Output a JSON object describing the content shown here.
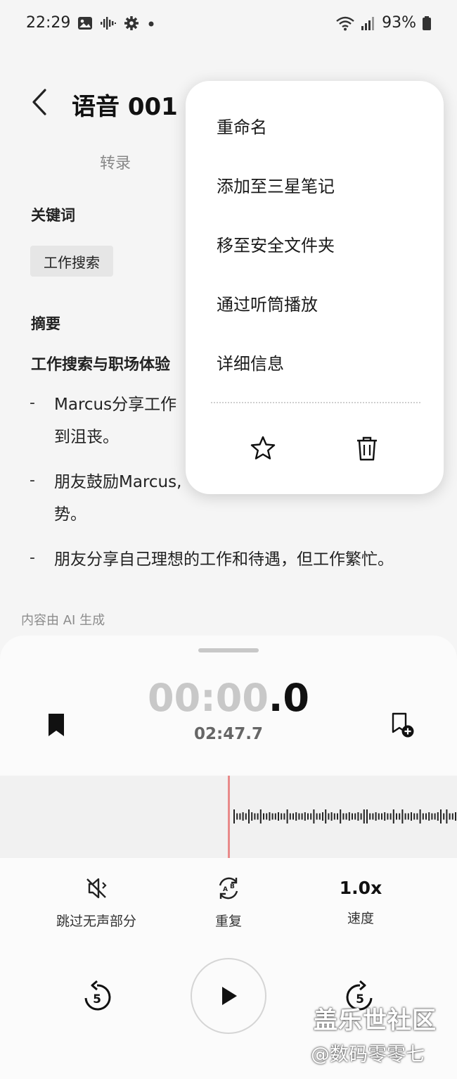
{
  "status": {
    "time": "22:29",
    "battery": "93%"
  },
  "header": {
    "title": "语音 001",
    "tab": "转录"
  },
  "content": {
    "keywords_heading": "关键词",
    "keyword": "工作搜索",
    "summary_heading": "摘要",
    "summary_title": "工作搜索与职场体验",
    "bullets": [
      "Marcus分享工作 到沮丧。",
      "朋友鼓励Marcus, 势。",
      "朋友分享自己理想的工作和待遇，但工作繁忙。"
    ],
    "ai_note": "内容由 AI 生成"
  },
  "player": {
    "timer_dim": "00:00",
    "timer_strong": ".0",
    "duration": "02:47.7",
    "skip_silence_label": "跳过无声部分",
    "repeat_label": "重复",
    "speed_value": "1.0x",
    "speed_label": "速度",
    "rewind_seconds": "5",
    "forward_seconds": "5"
  },
  "menu": {
    "items": [
      "重命名",
      "添加至三星笔记",
      "移至安全文件夹",
      "通过听筒播放",
      "详细信息"
    ]
  },
  "watermark": {
    "line1": "盖乐世社区",
    "line2": "@数码零零七"
  },
  "colors": {
    "playhead": "#e88a8a",
    "background": "#f5f5f5"
  }
}
